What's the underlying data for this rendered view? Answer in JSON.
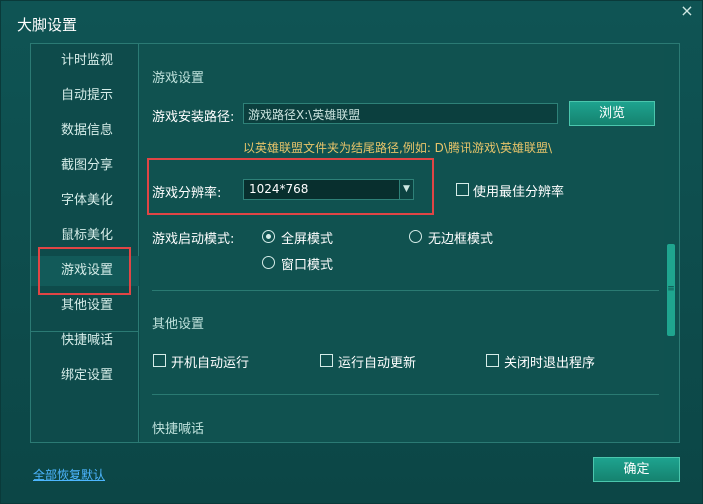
{
  "window": {
    "title": "大脚设置",
    "close_glyph": "×"
  },
  "sidebar": {
    "items": [
      {
        "label": "计时监视"
      },
      {
        "label": "自动提示"
      },
      {
        "label": "数据信息"
      },
      {
        "label": "截图分享"
      },
      {
        "label": "字体美化"
      },
      {
        "label": "鼠标美化"
      },
      {
        "label": "游戏设置"
      },
      {
        "label": "其他设置"
      },
      {
        "label": "快捷喊话"
      },
      {
        "label": "绑定设置"
      }
    ],
    "active_label": "游戏设置"
  },
  "game_settings": {
    "section_title": "游戏设置",
    "install_path_label": "游戏安装路径:",
    "install_path_value": "游戏路径X:\\英雄联盟",
    "browse_label": "浏览",
    "hint": "以英雄联盟文件夹为结尾路径,例如: D\\腾讯游戏\\英雄联盟\\",
    "resolution_label": "游戏分辨率:",
    "resolution_value": "1024*768",
    "best_resolution_label": "使用最佳分辨率",
    "launch_mode_label": "游戏启动模式:",
    "launch_modes": [
      {
        "label": "全屏模式",
        "selected": true
      },
      {
        "label": "无边框模式",
        "selected": false
      },
      {
        "label": "窗口模式",
        "selected": false
      }
    ]
  },
  "other_settings": {
    "section_title": "其他设置",
    "options": [
      {
        "label": "开机自动运行",
        "checked": false
      },
      {
        "label": "运行自动更新",
        "checked": false
      },
      {
        "label": "关闭时退出程序",
        "checked": false
      }
    ]
  },
  "quick_chat": {
    "section_title": "快捷喊话"
  },
  "footer": {
    "reset_label": "全部恢复默认",
    "ok_label": "确定"
  },
  "icons": {
    "dropdown": "chevron-down-icon",
    "close": "close-icon",
    "scroll_grip": "grip-icon"
  },
  "colors": {
    "accent": "#1ea38f",
    "highlight_box": "#e04545",
    "hint": "#e7c46a",
    "link": "#4db6ff"
  }
}
